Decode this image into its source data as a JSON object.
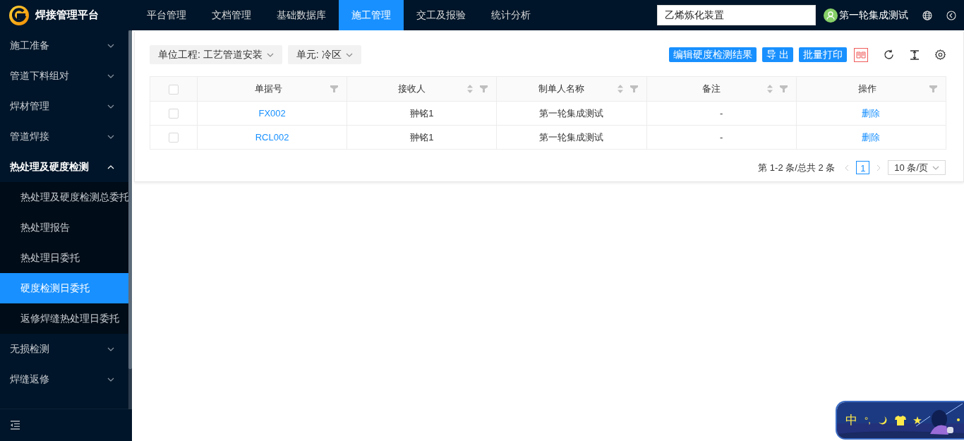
{
  "header": {
    "logo_text": "焊接管理平台",
    "nav": [
      {
        "label": "平台管理",
        "selected": false
      },
      {
        "label": "文档管理",
        "selected": false
      },
      {
        "label": "基础数据库",
        "selected": false
      },
      {
        "label": "施工管理",
        "selected": true
      },
      {
        "label": "交工及报验",
        "selected": false
      },
      {
        "label": "统计分析",
        "selected": false
      }
    ],
    "project_field": {
      "value": "乙烯炼化装置"
    },
    "user": "第一轮集成测试"
  },
  "sidebar": {
    "items": [
      {
        "label": "施工准备",
        "expanded": false
      },
      {
        "label": "管道下料组对",
        "expanded": false
      },
      {
        "label": "焊材管理",
        "expanded": false
      },
      {
        "label": "管道焊接",
        "expanded": false
      },
      {
        "label": "热处理及硬度检测",
        "expanded": true,
        "children": [
          {
            "label": "热处理及硬度检测总委托",
            "selected": false
          },
          {
            "label": "热处理报告",
            "selected": false
          },
          {
            "label": "热处理日委托",
            "selected": false
          },
          {
            "label": "硬度检测日委托",
            "selected": true
          },
          {
            "label": "返修焊缝热处理日委托",
            "selected": false
          }
        ]
      },
      {
        "label": "无损检测",
        "expanded": false
      },
      {
        "label": "焊缝返修",
        "expanded": false
      }
    ]
  },
  "filters": [
    {
      "label": "单位工程: 工艺管道安装"
    },
    {
      "label": "单元: 冷区"
    }
  ],
  "toolbar_buttons": [
    "编辑硬度检测结果",
    "导 出",
    "批量打印"
  ],
  "table": {
    "select_all": {
      "checked": false
    },
    "columns": [
      {
        "label": "单据号",
        "kind": "link",
        "sortable": false
      },
      {
        "label": "接收人",
        "kind": "text",
        "sortable": true
      },
      {
        "label": "制单人名称",
        "kind": "text",
        "sortable": true
      },
      {
        "label": "备注",
        "kind": "text",
        "sortable": true
      },
      {
        "label": "操作",
        "kind": "link",
        "sortable": false
      }
    ],
    "rows": [
      {
        "checked": false,
        "cells": [
          "FX002",
          "翀铭1",
          "第一轮集成测试",
          "-",
          "删除"
        ]
      },
      {
        "checked": false,
        "cells": [
          "RCL002",
          "翀铭1",
          "第一轮集成测试",
          "-",
          "删除"
        ]
      }
    ]
  },
  "pagination": {
    "summary": "第 1-2 条/总共 2 条",
    "pages": [
      {
        "label": "1",
        "selected": true
      }
    ],
    "page_size": "10 条/页"
  },
  "ime_bar": {
    "mode": "中",
    "punctuation": "°,"
  }
}
